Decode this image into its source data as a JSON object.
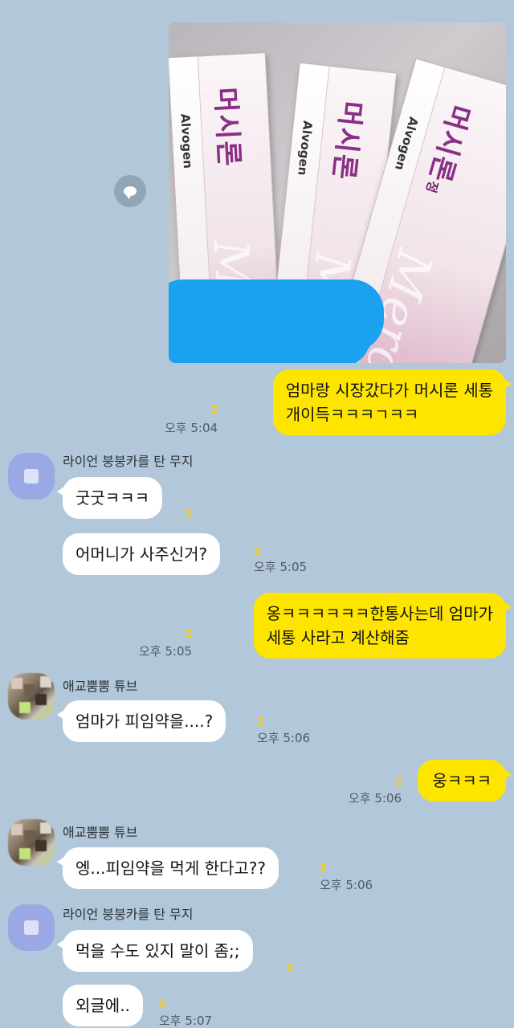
{
  "chat": {
    "photo": {
      "brand": "Alvogen",
      "product": "머시론",
      "product_suffix": "정",
      "script_text": "Mercilon"
    },
    "messages": [
      {
        "side": "me",
        "lines": [
          "엄마랑 시장갔다가 머시론 세통",
          "개이득ㅋㅋㅋㄱㅋㅋ"
        ],
        "time": "오후 5:04",
        "unread": "2"
      },
      {
        "side": "them",
        "sender": "라이언 붕붕카를 탄 무지",
        "text": "굿굿ㅋㅋㅋ",
        "unread": "2"
      },
      {
        "side": "them",
        "text": "어머니가 사주신거?",
        "time": "오후 5:05",
        "unread": "2"
      },
      {
        "side": "me",
        "lines": [
          "옹ㅋㅋㅋㅋㅋㅋ한통사는데 엄마가",
          "세통 사라고 계산해줌"
        ],
        "time": "오후 5:05",
        "unread": "2"
      },
      {
        "side": "them",
        "sender": "애교뿜뿜 튜브",
        "text": "엄마가 피임약을....?",
        "time": "오후 5:06",
        "unread": "2"
      },
      {
        "side": "me",
        "text": "웅ㅋㅋㅋ",
        "time": "오후 5:06",
        "unread": "2"
      },
      {
        "side": "them",
        "sender": "애교뿜뿜 튜브",
        "text": "엥...피임약을 먹게 한다고??",
        "time": "오후 5:06",
        "unread": "2"
      },
      {
        "side": "them",
        "sender": "라이언 붕붕카를 탄 무지",
        "text": "먹을 수도 있지 말이 좀;;",
        "unread": "2"
      },
      {
        "side": "them",
        "text": "외글에..",
        "time": "오후 5:07",
        "unread": "2"
      }
    ]
  },
  "icons": {
    "share": "share-icon",
    "avatar_generic": "default-avatar-icon",
    "avatar_photo": "profile-photo"
  },
  "colors": {
    "background": "#b2c7d9",
    "my_bubble": "#fee500",
    "their_bubble": "#ffffff",
    "unread": "#f3cc1a",
    "redaction": "#1aa2f0"
  }
}
